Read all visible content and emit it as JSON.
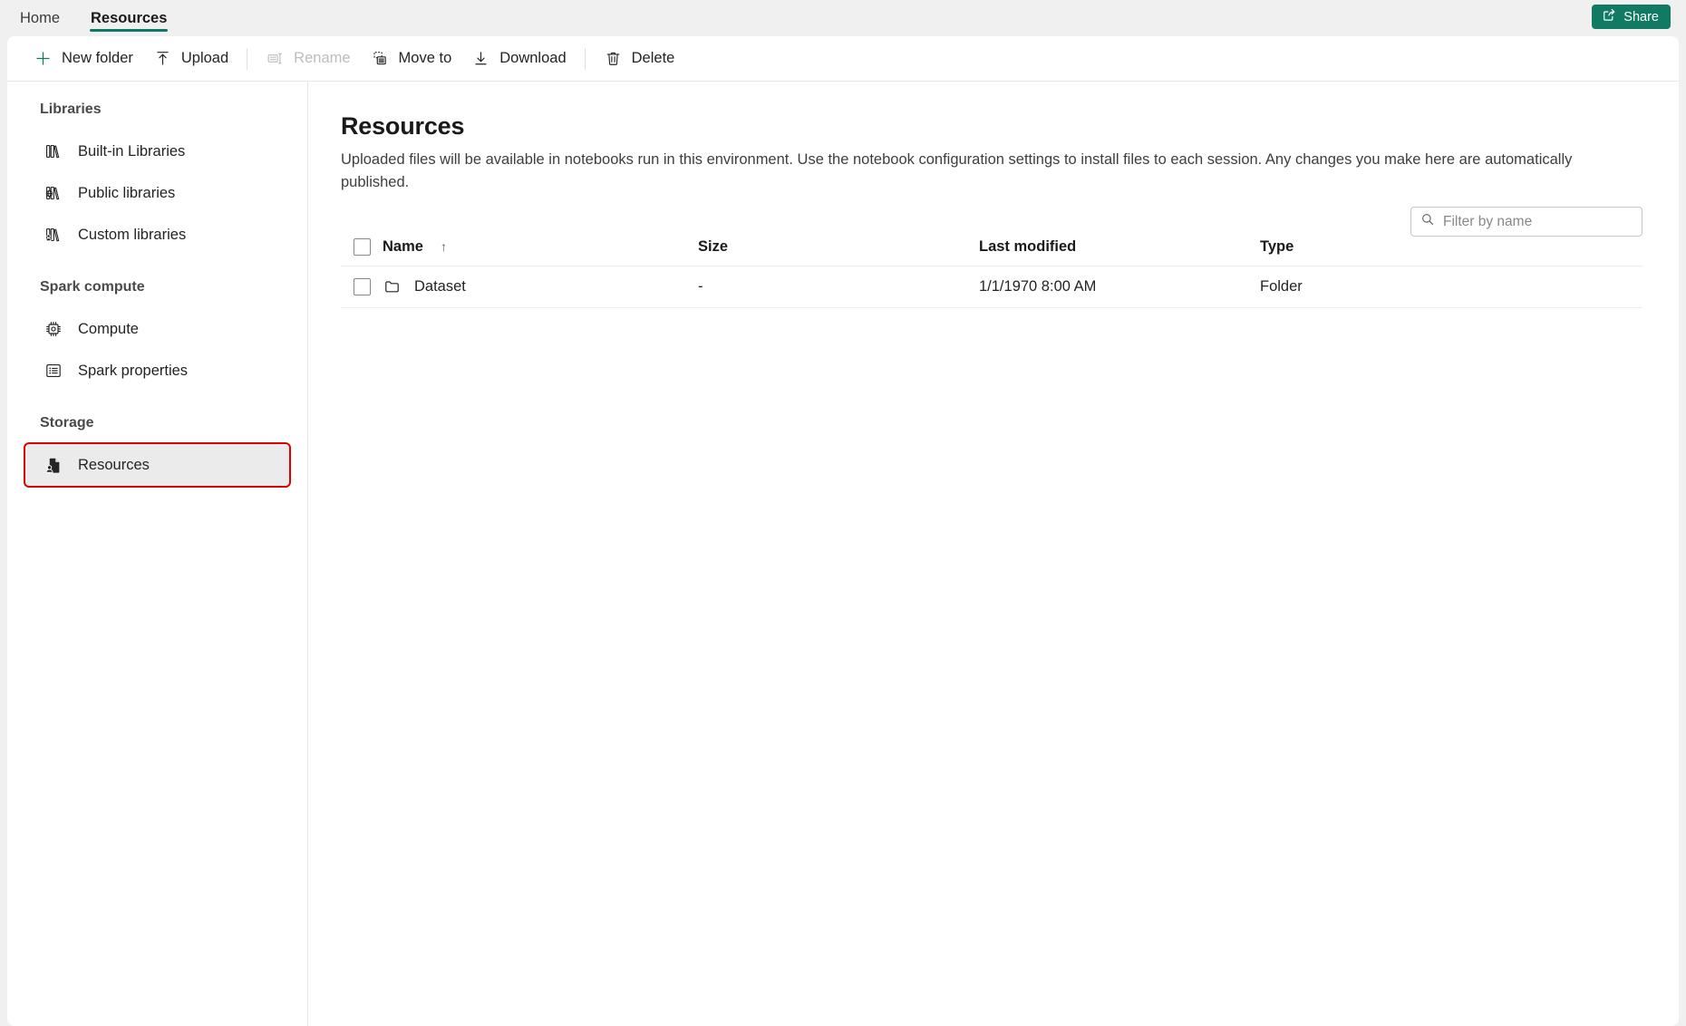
{
  "tabs": [
    {
      "label": "Home",
      "active": false
    },
    {
      "label": "Resources",
      "active": true
    }
  ],
  "share": {
    "label": "Share",
    "icon": "share-icon",
    "color": "#107a63"
  },
  "toolbar": {
    "new_folder": "New folder",
    "upload": "Upload",
    "rename": "Rename",
    "move_to": "Move to",
    "download": "Download",
    "delete": "Delete"
  },
  "sidebar": {
    "groups": [
      {
        "title": "Libraries",
        "items": [
          {
            "label": "Built-in Libraries",
            "icon": "books-icon"
          },
          {
            "label": "Public libraries",
            "icon": "public-books-icon"
          },
          {
            "label": "Custom libraries",
            "icon": "custom-books-icon"
          }
        ]
      },
      {
        "title": "Spark compute",
        "items": [
          {
            "label": "Compute",
            "icon": "cpu-icon"
          },
          {
            "label": "Spark properties",
            "icon": "list-icon"
          }
        ]
      },
      {
        "title": "Storage",
        "items": [
          {
            "label": "Resources",
            "icon": "resources-icon",
            "selected": true
          }
        ]
      }
    ]
  },
  "main": {
    "title": "Resources",
    "description": "Uploaded files will be available in notebooks run in this environment. Use the notebook configuration settings to install files to each session. Any changes you make here are automatically published.",
    "filter": {
      "placeholder": "Filter by name",
      "value": "",
      "icon": "search-icon"
    },
    "table": {
      "columns": [
        "Name",
        "Size",
        "Last modified",
        "Type"
      ],
      "sort": {
        "column": "Name",
        "direction": "↑"
      },
      "rows": [
        {
          "name": "Dataset",
          "size": "-",
          "modified": "1/1/1970 8:00 AM",
          "type": "Folder",
          "icon": "folder-icon"
        }
      ]
    }
  },
  "accent": {
    "tab_underline": "#117865",
    "highlight_border": "#e00000"
  }
}
